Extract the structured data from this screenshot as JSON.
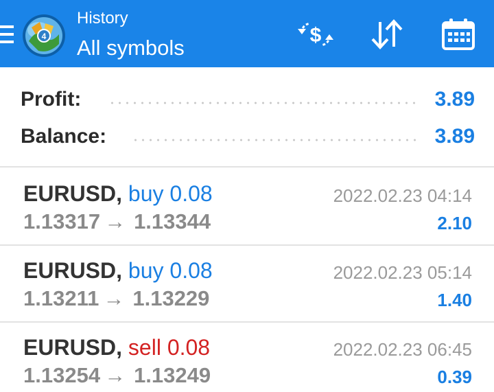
{
  "header": {
    "subtitle": "History",
    "title": "All symbols"
  },
  "icons": {
    "menu": "hamburger-icon",
    "logo": "metatrader-logo",
    "deposit_withdraw": "currency-exchange-icon",
    "sort": "sort-icon",
    "calendar": "calendar-icon"
  },
  "colors": {
    "appbar": "#1a84e8",
    "accent_blue": "#1a7fe2",
    "sell_red": "#d32222"
  },
  "summary": {
    "profit_label": "Profit:",
    "profit_value": "3.89",
    "balance_label": "Balance:",
    "balance_value": "3.89"
  },
  "deals": [
    {
      "symbol": "EURUSD,",
      "side": "buy",
      "volume": "0.08",
      "open_price": "1.13317",
      "arrow": "→",
      "close_price": "1.13344",
      "time": "2022.02.23 04:14",
      "profit": "2.10"
    },
    {
      "symbol": "EURUSD,",
      "side": "buy",
      "volume": "0.08",
      "open_price": "1.13211",
      "arrow": "→",
      "close_price": "1.13229",
      "time": "2022.02.23 05:14",
      "profit": "1.40"
    },
    {
      "symbol": "EURUSD,",
      "side": "sell",
      "volume": "0.08",
      "open_price": "1.13254",
      "arrow": "→",
      "close_price": "1.13249",
      "time": "2022.02.23 06:45",
      "profit": "0.39"
    }
  ]
}
